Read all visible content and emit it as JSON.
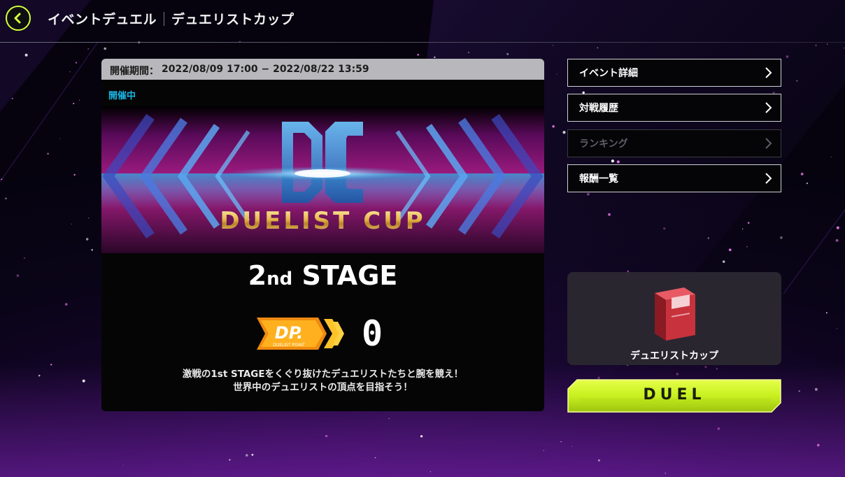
{
  "header": {
    "title_event": "イベントデュエル",
    "title_name": "デュエリストカップ",
    "back_icon": "chevron-left-icon",
    "accent_color": "#d6ff3a"
  },
  "event": {
    "period_label": "開催期間：",
    "period_value": "2022/08/09 17:00 − 2022/08/22 13:59",
    "status": "開催中",
    "status_color": "#18b8e6",
    "logo_text": "DUELIST CUP",
    "stage_number": "2",
    "stage_suffix": "nd",
    "stage_word": "STAGE",
    "dp_badge_text": "DP.",
    "dp_badge_sub": "DUELIST POINT",
    "dp_value": "0",
    "description_line1": "激戦の1st STAGEをくぐり抜けたデュエリストたちと腕を競え！",
    "description_line2": "世界中のデュエリストの頂点を目指そう！"
  },
  "menu": {
    "items": [
      {
        "label": "イベント詳細",
        "enabled": true
      },
      {
        "label": "対戦履歴",
        "enabled": true
      },
      {
        "label": "ランキング",
        "enabled": false
      },
      {
        "label": "報酬一覧",
        "enabled": true
      }
    ]
  },
  "deck": {
    "name": "デュエリストカップ",
    "box_color": "#c8323c"
  },
  "duel_button": {
    "label": "DUEL",
    "color": "#c8f020"
  }
}
